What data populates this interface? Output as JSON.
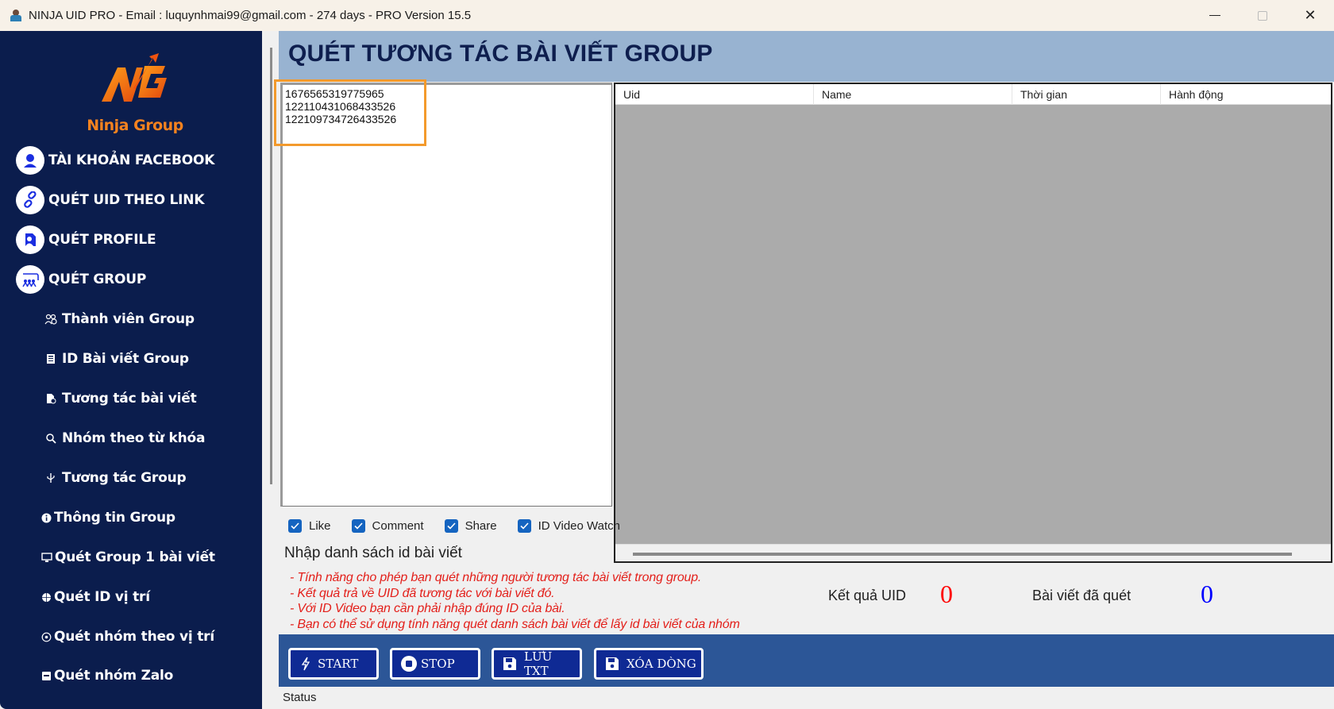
{
  "window": {
    "title": "NINJA UID PRO - Email : luquynhmai99@gmail.com - 274 days -  PRO Version 15.5",
    "controls": {
      "minimize": "minimize",
      "maximize": "maximize",
      "close": "✕"
    }
  },
  "sidebar": {
    "logo_text": "Ninja Group",
    "main_items": [
      {
        "label": "TÀI KHOẢN FACEBOOK",
        "icon": "user-icon"
      },
      {
        "label": "QUÉT UID THEO LINK",
        "icon": "link-icon"
      },
      {
        "label": "QUÉT PROFILE",
        "icon": "profile-icon"
      },
      {
        "label": "QUÉT GROUP",
        "icon": "group-icon"
      }
    ],
    "sub_items": [
      {
        "label": "Thành viên Group",
        "icon": "members-icon"
      },
      {
        "label": "ID Bài viết Group",
        "icon": "document-icon"
      },
      {
        "label": "Tương tác bài viết",
        "icon": "post-interaction-icon"
      },
      {
        "label": "Nhóm theo từ khóa",
        "icon": "search-icon"
      },
      {
        "label": "Tương tác Group",
        "icon": "usb-icon"
      },
      {
        "label": "Thông tin Group",
        "icon": "info-icon"
      },
      {
        "label": "Quét Group 1 bài viết",
        "icon": "monitor-icon"
      },
      {
        "label": "Quét  ID vị trí",
        "icon": "globe-icon"
      },
      {
        "label": "Quét nhóm theo vị trí",
        "icon": "target-icon"
      },
      {
        "label": "Quét nhóm Zalo",
        "icon": "chat-icon"
      }
    ]
  },
  "header": {
    "title": "QUÉT TƯƠNG TÁC BÀI VIẾT GROUP"
  },
  "input": {
    "post_ids": "1676565319775965\n122110431068433526\n122109734726433526",
    "label": "Nhập danh sách id bài viết"
  },
  "table": {
    "columns": [
      "Uid",
      "Name",
      "Thời gian",
      "Hành động"
    ],
    "rows": []
  },
  "options": [
    {
      "label": "Like",
      "checked": true
    },
    {
      "label": "Comment",
      "checked": true
    },
    {
      "label": "Share",
      "checked": true
    },
    {
      "label": "ID Video Watch",
      "checked": true
    }
  ],
  "notes": [
    "- Tính năng cho phép bạn quét những người tương tác bài viết trong group.",
    "- Kết quả trả về UID đã tương tác với bài viết đó.",
    "- Với ID Video bạn cần phải nhập đúng ID của bài.",
    "- Bạn có thể sử dụng tính năng quét danh sách bài viết để lấy id bài viết của nhóm"
  ],
  "stats": {
    "uid_label": "Kết quả UID",
    "uid_value": "0",
    "uid_color": "#ff0000",
    "posts_label": "Bài viết đã quét",
    "posts_value": "0",
    "posts_color": "#0000ff"
  },
  "buttons": {
    "start": "START",
    "stop": "STOP",
    "save_txt": "LƯU TXT",
    "delete_rows": "XÓA DÒNG"
  },
  "status": {
    "text": "Status"
  },
  "colors": {
    "sidebar_bg": "#0b1d4d",
    "header_bg": "#98b3d1",
    "button_bar_bg": "#2c5697",
    "button_bg": "#0f2a94",
    "logo_orange": "#f5821f",
    "highlight_orange": "#f39a2c"
  }
}
